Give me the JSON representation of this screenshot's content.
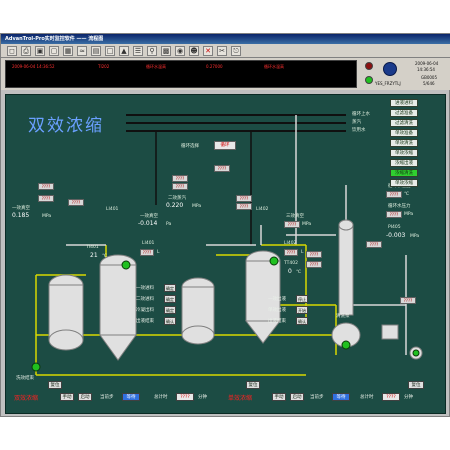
{
  "window": {
    "title": "AdvanTrol-Pro实时监控软件 —— 流程图"
  },
  "toolbar": {
    "icons": [
      "folder-icon",
      "print-icon",
      "save-icon",
      "monitor-icon",
      "chart-icon",
      "trend-icon",
      "grid-icon",
      "screen-icon",
      "alarm-icon",
      "report-icon",
      "zoom-icon",
      "group-icon",
      "lock-icon",
      "user-icon",
      "close-icon",
      "cut-icon",
      "exit-icon"
    ]
  },
  "alarm_bar": {
    "datetime": "2009-06-04 14:36:52",
    "tag": "TI202",
    "desc": "循环水温高",
    "value": "0.27000",
    "state": "循环水温高"
  },
  "status_panel": {
    "date": "2009-06-04",
    "time": "14:36:54",
    "user": "YES_FRZYTLJ",
    "code": "GB0005",
    "page": "5/646"
  },
  "process": {
    "title": "双效浓缩",
    "water_labels": [
      "循环上水",
      "蒸汽",
      "饮用水"
    ],
    "mode_label": "循环选择",
    "mode_value": "循环",
    "pressure_label_1": "一效真空",
    "pressure_value_1": "0.185",
    "pressure_unit": "MPa",
    "tank_labels": [
      "LI401",
      "LI402",
      "LI403",
      "LI404"
    ],
    "vacuum_label_1": "一效真空",
    "vacuum_value_1": "-0.014",
    "vacuum_unit": "Pa",
    "steam_label": "二效蒸汽",
    "steam_value": "0.220",
    "steam_unit": "MPa",
    "temp_label": "TI401",
    "temp_value": "21",
    "temp_unit": "℃",
    "level_label": "LI401",
    "level_value": "????",
    "level_unit": "L",
    "vacuum_label_2": "三效真空",
    "vacuum_value_2": "????",
    "vacuum_unit_2": "MPa",
    "li402_label": "LI402",
    "li402_value": "????",
    "li402_unit": "L",
    "tt_label": "TT402",
    "tt_value": "0",
    "tt_unit": "℃",
    "q_box": "????",
    "right_temp_label": "循环水温度",
    "right_temp_value": "????",
    "right_temp_unit": "℃",
    "right_press_label": "循环水压力",
    "right_press_value": "????",
    "right_press_unit": "MPa",
    "pi_label": "PI405",
    "pi_value": "-0.003",
    "pi_unit": "MPa",
    "controls_left": [
      {
        "label": "一效进料",
        "button": "确定"
      },
      {
        "label": "二效进料",
        "button": "确定"
      },
      {
        "label": "冷凝出料",
        "button": "确定"
      },
      {
        "label": "出液结束",
        "button": "确认"
      }
    ],
    "controls_mid": [
      {
        "label": "一效出液",
        "button": "停止"
      },
      {
        "label": "单效出液",
        "button": "开始"
      },
      {
        "label": "出液结束",
        "button": "确认"
      }
    ],
    "clean_label": "清洗泵",
    "clean_button": "清洗",
    "side_buttons": [
      "进液进料",
      "过滤准备",
      "过滤清洗",
      "单效准备",
      "单效清洗",
      "单效浓缩",
      "浓缩出液",
      "浓缩清洗",
      "单效浓缩",
      "出液"
    ],
    "side_buttons_green": [
      false,
      false,
      false,
      false,
      false,
      false,
      false,
      true,
      false,
      false
    ]
  },
  "bottom_bar": {
    "reset_label": "复位",
    "reset_left": "复位",
    "reset_right": "复位",
    "left_title": "双效浓缩",
    "right_title": "单效浓缩",
    "manual": "手动",
    "start": "启动",
    "current_step": "当前步",
    "waiting": "等待",
    "total_time": "总计时",
    "time_value": "????",
    "minutes": "分钟",
    "left_clean": "洗效结束"
  }
}
